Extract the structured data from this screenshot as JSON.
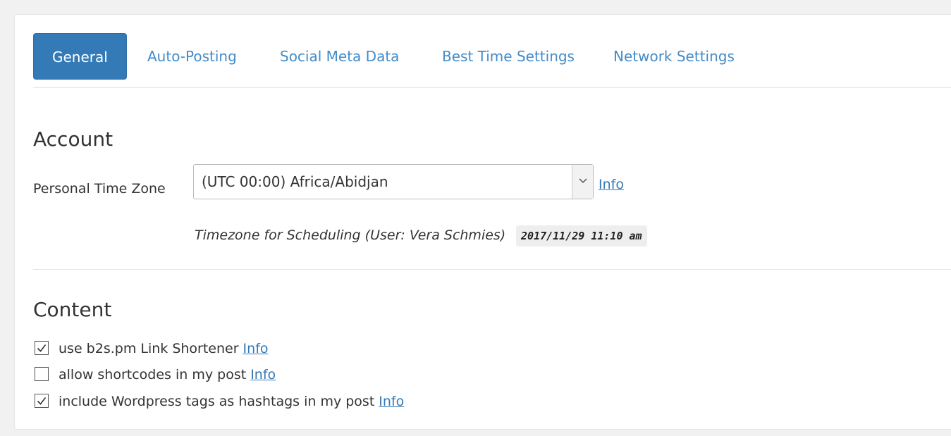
{
  "tabs": [
    {
      "label": "General",
      "active": true
    },
    {
      "label": "Auto-Posting",
      "active": false
    },
    {
      "label": "Social Meta Data",
      "active": false
    },
    {
      "label": "Best Time Settings",
      "active": false
    },
    {
      "label": "Network Settings",
      "active": false
    }
  ],
  "account": {
    "title": "Account",
    "timezone_label": "Personal Time Zone",
    "timezone_value": "(UTC 00:00) Africa/Abidjan",
    "info_link": "Info",
    "note": "Timezone for Scheduling (User: Vera Schmies)",
    "timestamp": "2017/11/29 11:10 am"
  },
  "content": {
    "title": "Content",
    "options": [
      {
        "label": "use b2s.pm Link Shortener",
        "checked": true,
        "info": "Info"
      },
      {
        "label": "allow shortcodes in my post",
        "checked": false,
        "info": "Info"
      },
      {
        "label": "include Wordpress tags as hashtags in my post",
        "checked": true,
        "info": "Info"
      }
    ]
  },
  "colors": {
    "accent": "#337ab7",
    "tab_text": "#428bca",
    "link": "#337ab7"
  },
  "icons": {
    "select_arrow": "chevron-down-icon",
    "checkbox_checked": "checkmark-icon"
  }
}
